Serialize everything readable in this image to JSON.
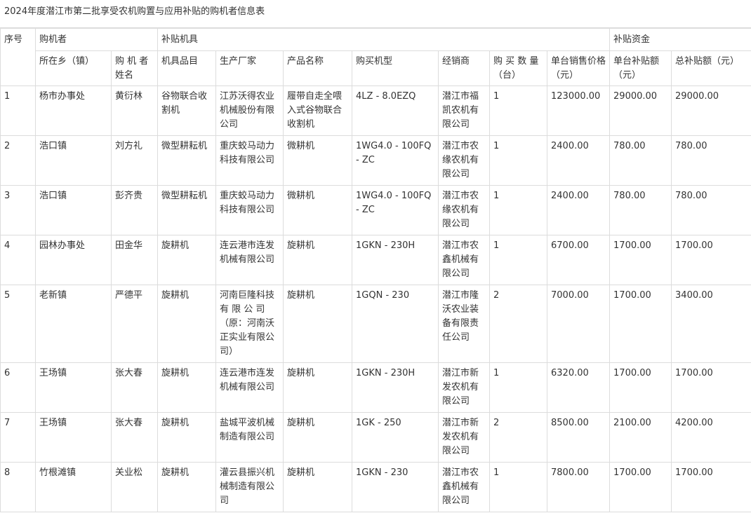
{
  "title": "2024年度潜江市第二批享受农机购置与应用补贴的购机者信息表",
  "header": {
    "seq": "序号",
    "buyer": "购机者",
    "equipment": "补贴机具",
    "funds": "补贴资金",
    "township": "所在乡（镇）",
    "buyer_name": "购 机 者 姓名",
    "category": "机具品目",
    "manufacturer": "生产厂家",
    "product": "产品名称",
    "model": "购买机型",
    "dealer": "经销商",
    "quantity": "购 买 数 量（台）",
    "unit_price": "单台销售价格（元）",
    "unit_subsidy": "单台补贴额（元）",
    "total_subsidy": "总补贴额（元）"
  },
  "rows": [
    {
      "seq": "1",
      "township": "杨市办事处",
      "name": "黄衍林",
      "category": "谷物联合收割机",
      "manufacturer": "江苏沃得农业机械股份有限公司",
      "product": "履带自走全喂入式谷物联合收割机",
      "model": "4LZ - 8.0EZQ",
      "dealer": "潜江市福凯农机有限公司",
      "qty": "1",
      "price": "123000.00",
      "subsidy": "29000.00",
      "total": "29000.00"
    },
    {
      "seq": "2",
      "township": "浩口镇",
      "name": "刘方礼",
      "category": "微型耕耘机",
      "manufacturer": "重庆蛟马动力科技有限公司",
      "product": "微耕机",
      "model": "1WG4.0 - 100FQ - ZC",
      "dealer": "潜江市农缘农机有限公司",
      "qty": "1",
      "price": "2400.00",
      "subsidy": "780.00",
      "total": "780.00"
    },
    {
      "seq": "3",
      "township": "浩口镇",
      "name": "彭齐贵",
      "category": "微型耕耘机",
      "manufacturer": "重庆蛟马动力科技有限公司",
      "product": "微耕机",
      "model": "1WG4.0 - 100FQ - ZC",
      "dealer": "潜江市农缘农机有限公司",
      "qty": "1",
      "price": "2400.00",
      "subsidy": "780.00",
      "total": "780.00"
    },
    {
      "seq": "4",
      "township": "园林办事处",
      "name": "田金华",
      "category": "旋耕机",
      "manufacturer": "连云港市连发机械有限公司",
      "product": "旋耕机",
      "model": "1GKN - 230H",
      "dealer": "潜江市农鑫机械有限公司",
      "qty": "1",
      "price": "6700.00",
      "subsidy": "1700.00",
      "total": "1700.00"
    },
    {
      "seq": "5",
      "township": "老新镇",
      "name": "严德平",
      "category": "旋耕机",
      "manufacturer": "河南巨隆科技有 限 公 司（原：河南沃正实业有限公司）",
      "product": "旋耕机",
      "model": "1GQN - 230",
      "dealer": "潜江市隆沃农业装备有限责任公司",
      "qty": "2",
      "price": "7000.00",
      "subsidy": "1700.00",
      "total": "3400.00"
    },
    {
      "seq": "6",
      "township": "王场镇",
      "name": "张大春",
      "category": "旋耕机",
      "manufacturer": "连云港市连发机械有限公司",
      "product": "旋耕机",
      "model": "1GKN - 230H",
      "dealer": "潜江市新发农机有限公司",
      "qty": "1",
      "price": "6320.00",
      "subsidy": "1700.00",
      "total": "1700.00"
    },
    {
      "seq": "7",
      "township": "王场镇",
      "name": "张大春",
      "category": "旋耕机",
      "manufacturer": "盐城平波机械制造有限公司",
      "product": "旋耕机",
      "model": "1GK - 250",
      "dealer": "潜江市新发农机有限公司",
      "qty": "2",
      "price": "8500.00",
      "subsidy": "2100.00",
      "total": "4200.00"
    },
    {
      "seq": "8",
      "township": "竹根滩镇",
      "name": "关业松",
      "category": "旋耕机",
      "manufacturer": "灌云县振兴机械制造有限公司",
      "product": "旋耕机",
      "model": "1GKN - 230",
      "dealer": "潜江市农鑫机械有限公司",
      "qty": "1",
      "price": "7800.00",
      "subsidy": "1700.00",
      "total": "1700.00"
    }
  ]
}
